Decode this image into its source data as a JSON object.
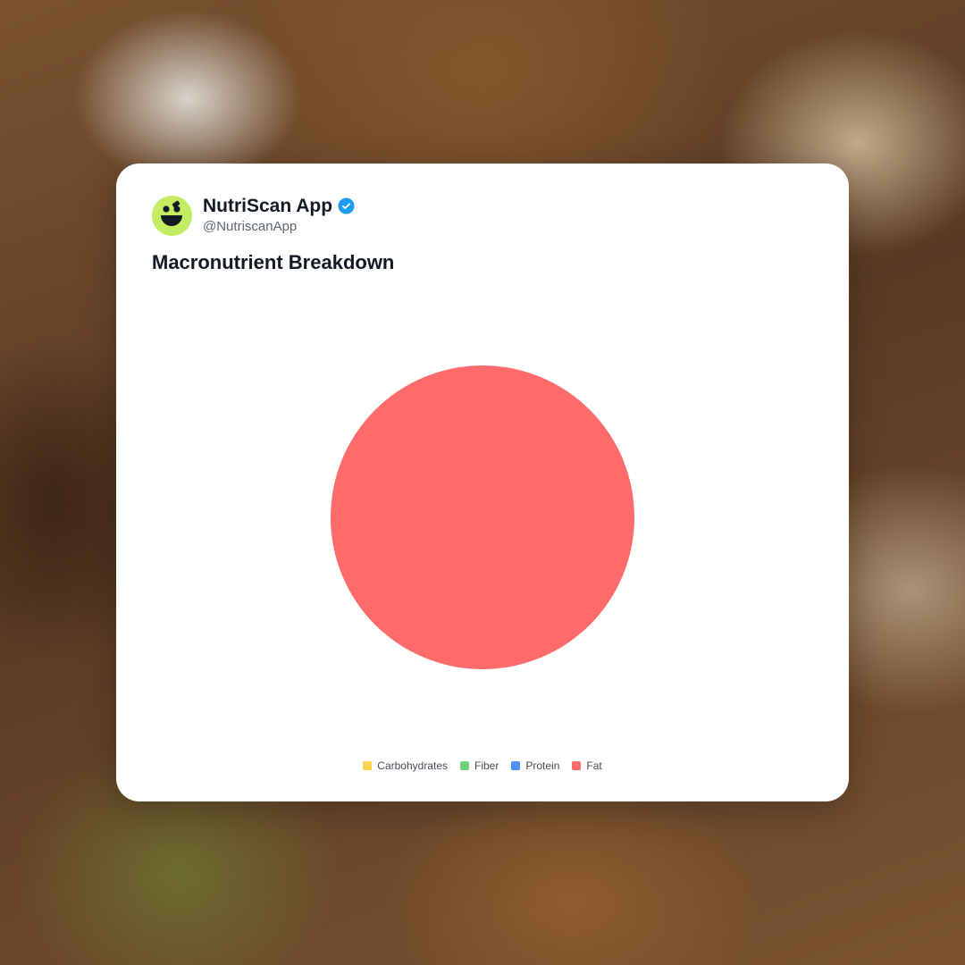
{
  "post": {
    "display_name": "NutriScan App",
    "handle": "@NutriscanApp",
    "verified": true,
    "avatar_icon": "nutriscan-logo-icon",
    "verified_icon": "verified-check-icon",
    "accent_color": "#c4ec63",
    "verified_color": "#1d9bf0"
  },
  "chart_data": {
    "type": "pie",
    "title": "Macronutrient Breakdown",
    "categories": [
      "Carbohydrates",
      "Fiber",
      "Protein",
      "Fat"
    ],
    "values": [
      0,
      0,
      0,
      100
    ],
    "colors": [
      "#fcd34d",
      "#6cd07a",
      "#4f8ff7",
      "#ff6b6b"
    ],
    "legend": "bottom"
  }
}
